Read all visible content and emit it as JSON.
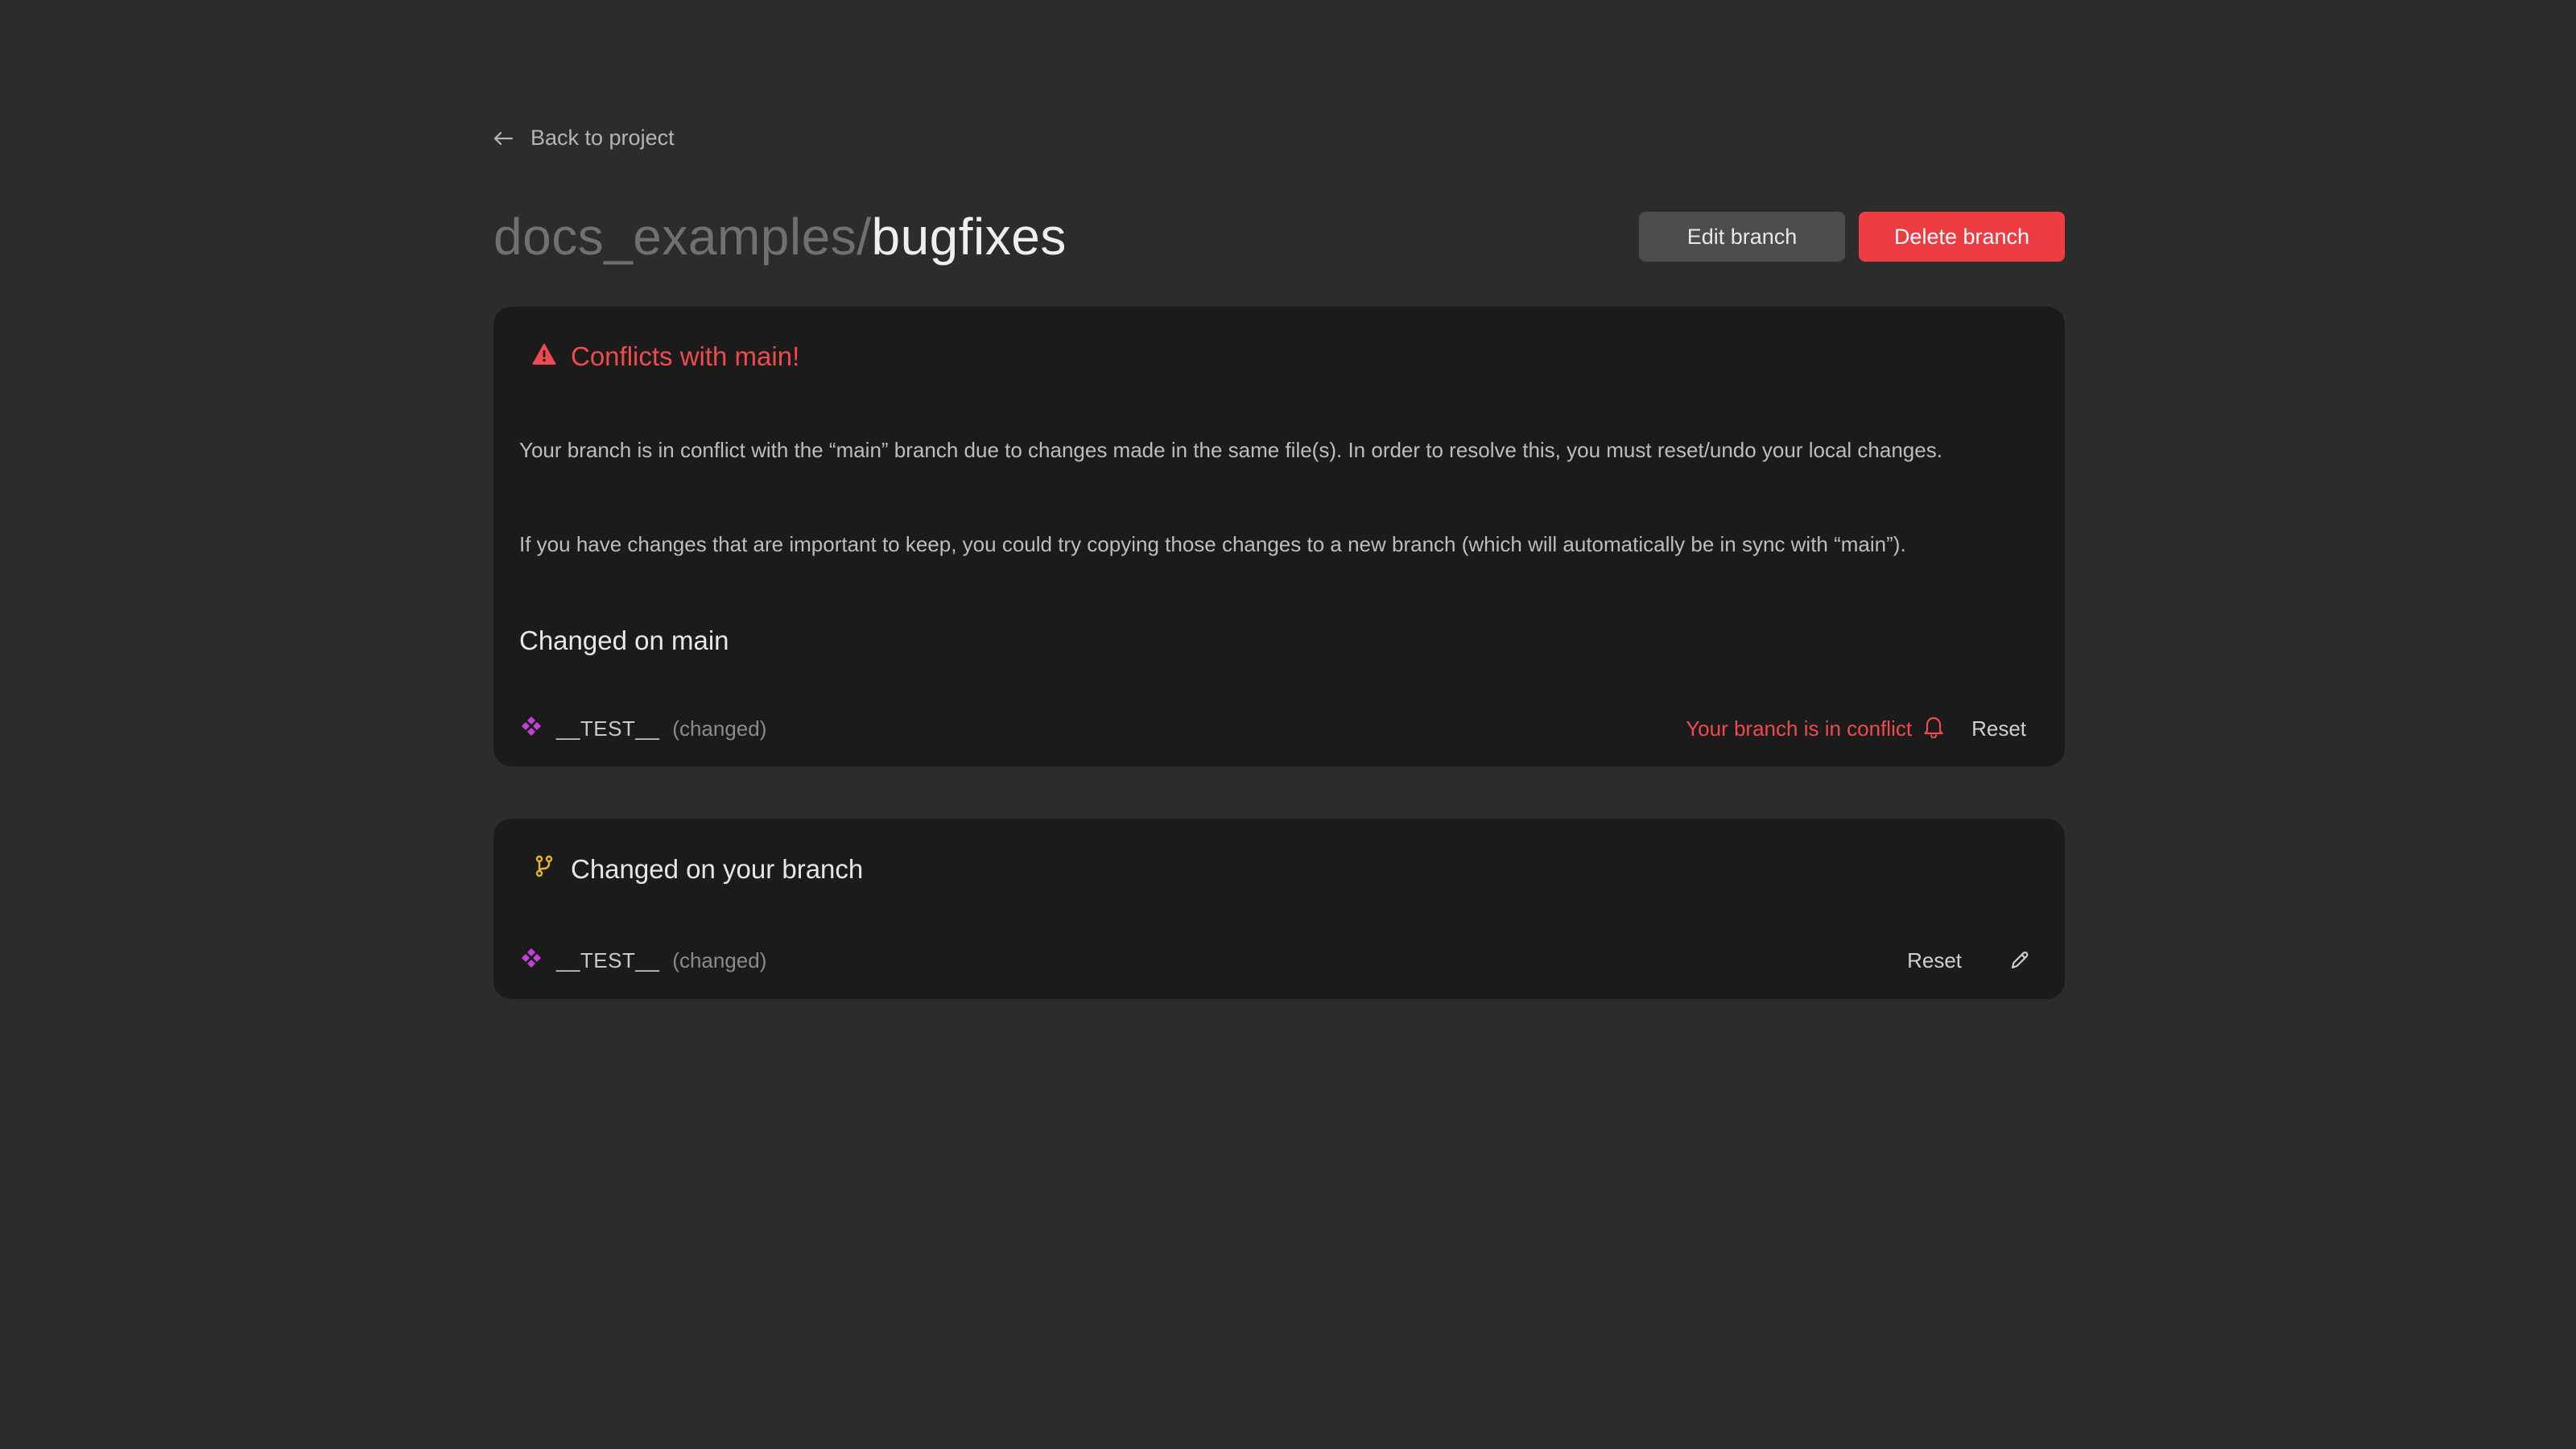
{
  "nav": {
    "back_label": "Back to project"
  },
  "header": {
    "project": "docs_examples/",
    "branch": "bugfixes",
    "edit_label": "Edit branch",
    "delete_label": "Delete branch"
  },
  "conflict": {
    "title": "Conflicts with main!",
    "paragraph1": "Your branch is in conflict with the “main” branch due to changes made in the same file(s). In order to resolve this, you must reset/undo your local changes.",
    "paragraph2": "If you have changes that are important to keep, you could try copying those changes to a new branch (which will automatically be in sync with “main”).",
    "section_title": "Changed on main",
    "item": {
      "name": "__TEST__",
      "status": "(changed)",
      "conflict_label": "Your branch is in conflict",
      "reset_label": "Reset"
    }
  },
  "branch_changes": {
    "title": "Changed on your branch",
    "item": {
      "name": "__TEST__",
      "status": "(changed)",
      "reset_label": "Reset"
    }
  },
  "colors": {
    "background": "#2c2c2c",
    "card": "#1b1b1b",
    "danger": "#ee3d42",
    "component_icon": "#c43fd6",
    "branch_icon": "#e8b52a"
  },
  "icons": {
    "back": "arrow-left-icon",
    "warning": "warning-triangle-icon",
    "component": "component-diamond-icon",
    "bell": "bell-icon",
    "branch": "git-branch-icon",
    "edit": "pencil-icon"
  }
}
